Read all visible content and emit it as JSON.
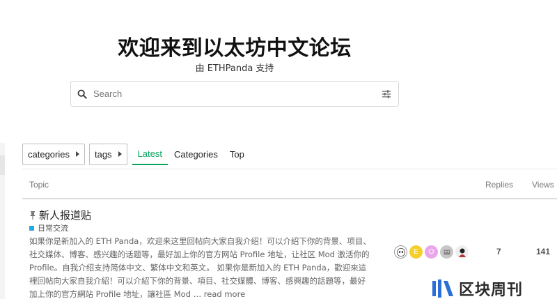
{
  "hero": {
    "title": "欢迎来到以太坊中文论坛",
    "subtitle": "由 ETHPanda 支持"
  },
  "search": {
    "placeholder": "Search",
    "icon": "search-icon",
    "options_icon": "sliders-icon"
  },
  "nav": {
    "categories_dropdown": "categories",
    "tags_dropdown": "tags",
    "tabs": [
      {
        "label": "Latest",
        "active": true
      },
      {
        "label": "Categories",
        "active": false
      },
      {
        "label": "Top",
        "active": false
      }
    ],
    "accent_color": "#08a25d"
  },
  "table": {
    "columns": {
      "topic": "Topic",
      "replies": "Replies",
      "views": "Views"
    },
    "rows": [
      {
        "pinned": true,
        "title": "新人报道贴",
        "category": "日常交流",
        "category_color": "#25aae1",
        "excerpt": "如果你是新加入的 ETH Panda，欢迎来这里回帖向大家自我介绍！可以介绍下你的背景、项目、社交媒体、博客、感兴趣的话题等，最好加上你的官方网站 Profile 地址，让社区 Mod 激活你的 Profile。自我介绍支持简体中文、繁体中文和英文。 如果你是新加入的 ETH Panda，歡迎來這裡回帖向大家自我介紹！可以介紹下你的背景、項目、社交媒體、博客、感興趣的話題等，最好加上你的官方網站 Profile 地址，讓社區 Mod …",
        "read_more": "read more",
        "poster_avatars": [
          {
            "icon": "panda-avatar-icon",
            "letter": ""
          },
          {
            "icon": "letter-avatar-icon",
            "letter": "E",
            "color": "#f5cf2a"
          },
          {
            "icon": "letter-avatar-icon",
            "letter": "O",
            "color": "#e9a6e8"
          },
          {
            "icon": "pixel-avatar-icon",
            "letter": ""
          },
          {
            "icon": "character-avatar-icon",
            "letter": ""
          }
        ],
        "replies": "7",
        "views": "141"
      }
    ]
  },
  "watermark": {
    "text": "区块周刊"
  }
}
